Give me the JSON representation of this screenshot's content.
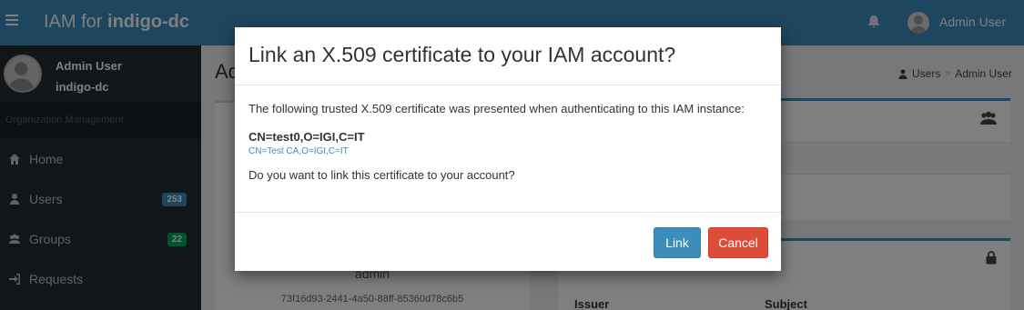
{
  "header": {
    "brand_prefix": "IAM for ",
    "brand_org": "indigo-dc",
    "user_name": "Admin User"
  },
  "sidebar": {
    "user_name": "Admin User",
    "organization": "indigo-dc",
    "section_label": "Organization Management",
    "items": [
      {
        "label": "Home",
        "icon": "home-icon"
      },
      {
        "label": "Users",
        "icon": "user-icon",
        "badge": "253"
      },
      {
        "label": "Groups",
        "icon": "users-icon",
        "badge": "22"
      },
      {
        "label": "Requests",
        "icon": "sign-in-icon"
      }
    ]
  },
  "content": {
    "title": "Ad",
    "breadcrumb": [
      "Users",
      "Admin User"
    ],
    "user_name_under": "admin",
    "uuid": "73f16d93-2441-4a50-88ff-85360d78c6b5",
    "table_headers": [
      "Issuer",
      "Subject"
    ]
  },
  "modal": {
    "title": "Link an X.509 certificate to your IAM account?",
    "intro": "The following trusted X.509 certificate was presented when authenticating to this IAM instance:",
    "subject": "CN=test0,O=IGI,C=IT",
    "issuer": "CN=Test CA,O=IGI,C=IT",
    "question": "Do you want to link this certificate to your account?",
    "link_label": "Link",
    "cancel_label": "Cancel"
  },
  "colors": {
    "header": "#3c8dbc",
    "sidebar": "#222d32",
    "primary_button": "#3c8dbc",
    "danger_button": "#dd4b39",
    "badge_blue": "#3c8dbc",
    "badge_green": "#00a65a"
  }
}
